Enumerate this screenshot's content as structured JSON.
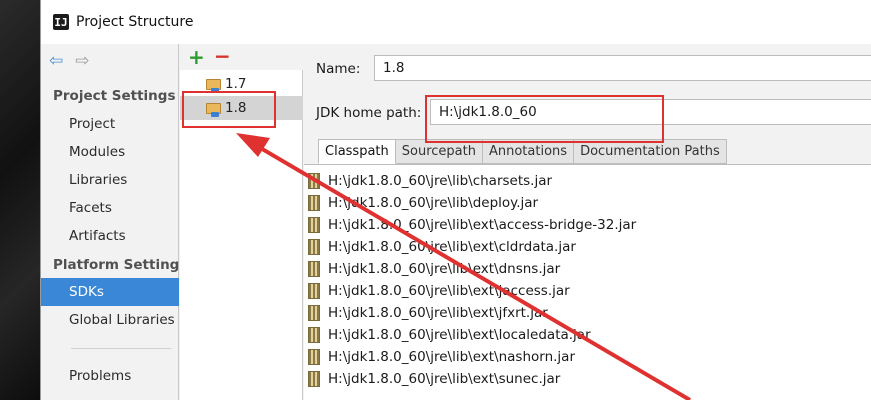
{
  "window": {
    "title": "Project Structure",
    "app_icon_glyph": "IJ"
  },
  "nav": {
    "back_icon": "back-arrow-icon",
    "forward_icon": "forward-arrow-icon",
    "project_settings_label": "Project Settings",
    "project_items": [
      "Project",
      "Modules",
      "Libraries",
      "Facets",
      "Artifacts"
    ],
    "platform_settings_label": "Platform Settings",
    "platform_items": [
      "SDKs",
      "Global Libraries"
    ],
    "selected_item": "SDKs",
    "problems_label": "Problems"
  },
  "sdk_list": {
    "add_icon": "plus-icon",
    "remove_icon": "minus-icon",
    "items": [
      "1.7",
      "1.8"
    ],
    "selected": "1.8"
  },
  "detail": {
    "name_label": "Name:",
    "name_value": "1.8",
    "jdk_home_label": "JDK home path:",
    "jdk_home_value": "H:\\jdk1.8.0_60",
    "tabs": [
      "Classpath",
      "Sourcepath",
      "Annotations",
      "Documentation Paths"
    ],
    "active_tab": "Classpath",
    "classpath": [
      "H:\\jdk1.8.0_60\\jre\\lib\\charsets.jar",
      "H:\\jdk1.8.0_60\\jre\\lib\\deploy.jar",
      "H:\\jdk1.8.0_60\\jre\\lib\\ext\\access-bridge-32.jar",
      "H:\\jdk1.8.0_60\\jre\\lib\\ext\\cldrdata.jar",
      "H:\\jdk1.8.0_60\\jre\\lib\\ext\\dnsns.jar",
      "H:\\jdk1.8.0_60\\jre\\lib\\ext\\jaccess.jar",
      "H:\\jdk1.8.0_60\\jre\\lib\\ext\\jfxrt.jar",
      "H:\\jdk1.8.0_60\\jre\\lib\\ext\\localedata.jar",
      "H:\\jdk1.8.0_60\\jre\\lib\\ext\\nashorn.jar",
      "H:\\jdk1.8.0_60\\jre\\lib\\ext\\sunec.jar"
    ]
  },
  "colors": {
    "selection_blue": "#3a87d7",
    "annotation_red": "#e03131",
    "add_green": "#2e9b2e",
    "remove_red": "#d9302a"
  }
}
